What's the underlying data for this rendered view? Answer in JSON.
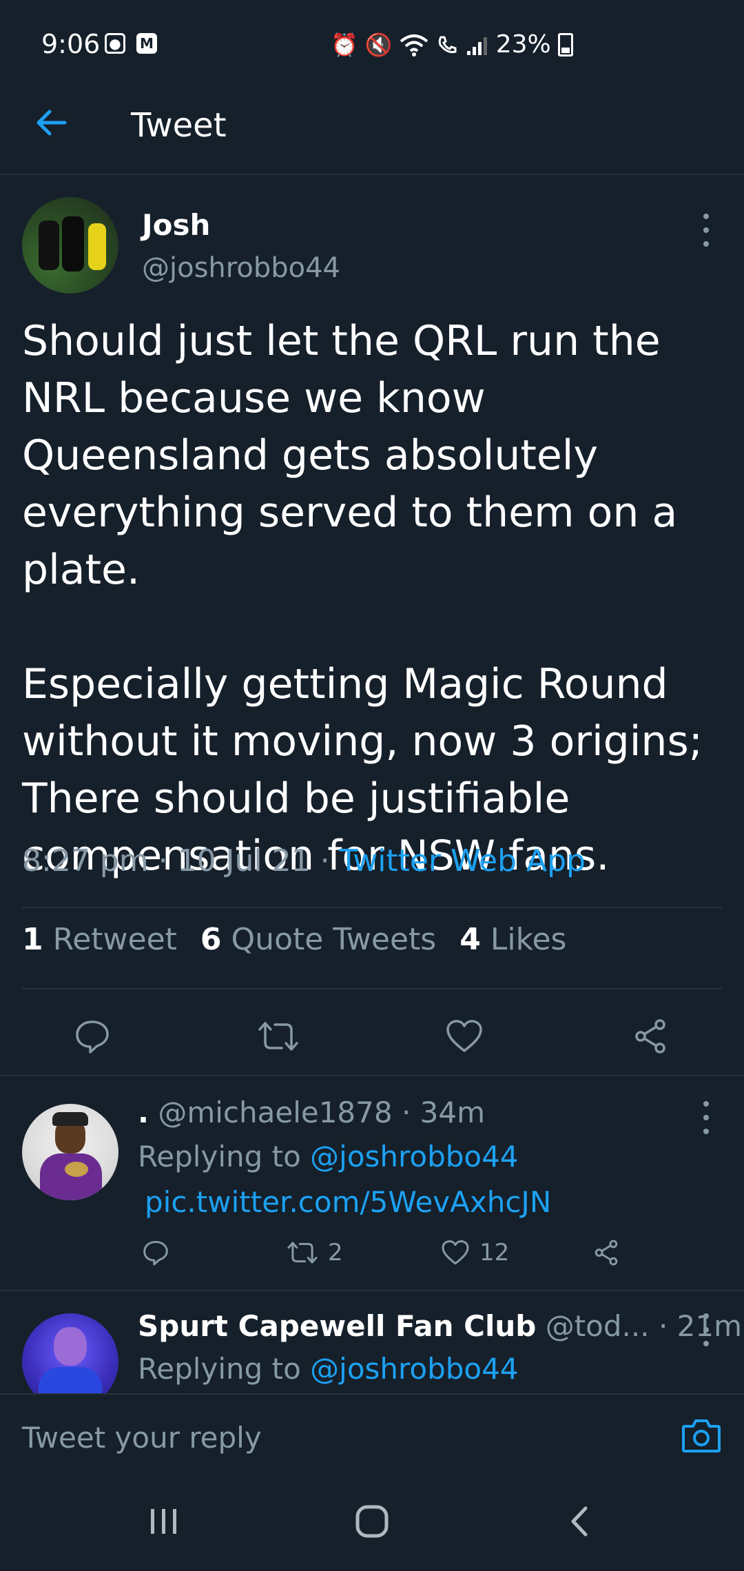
{
  "status_bar": {
    "time": "9:06",
    "battery": "23%"
  },
  "header": {
    "title": "Tweet"
  },
  "tweet": {
    "author_name": "Josh",
    "author_handle": "@joshrobbo44",
    "text": "Should just let the QRL run the NRL because we know Queensland gets absolutely everything served to them on a plate.\n\nEspecially getting Magic Round without it moving, now 3 origins; There should be justifiable compensation for NSW fans.",
    "time": "8:27 pm",
    "date": "10 Jul 21",
    "source": "Twitter Web App",
    "stats": {
      "retweets_count": "1",
      "retweets_label": "Retweet",
      "quotes_count": "6",
      "quotes_label": "Quote Tweets",
      "likes_count": "4",
      "likes_label": "Likes"
    }
  },
  "replies": [
    {
      "name": ".",
      "handle": "@michaele1878",
      "time": "34m",
      "replying_prefix": "Replying to",
      "replying_to": "@joshrobbo44",
      "link": "pic.twitter.com/5WevAxhcJN",
      "retweets": "2",
      "likes": "12"
    },
    {
      "name": "Spurt Capewell Fan Club",
      "handle": "@tod...",
      "time": "21m",
      "replying_prefix": "Replying to",
      "replying_to": "@joshrobbo44"
    }
  ],
  "compose": {
    "placeholder": "Tweet your reply"
  },
  "colors": {
    "background": "#15202b",
    "accent": "#1da1f2",
    "secondary_text": "#8899a6"
  }
}
